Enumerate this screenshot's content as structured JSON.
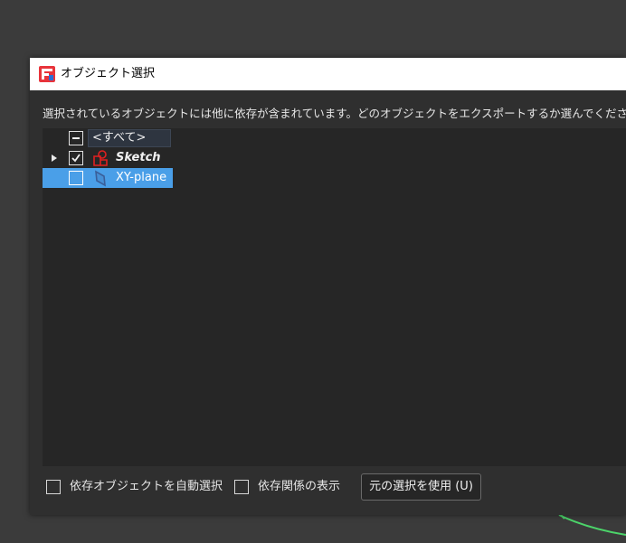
{
  "dialog": {
    "title": "オブジェクト選択",
    "message": "選択されているオブジェクトには他に依存が含まれています。どのオブジェクトをエクスポートするか選んでください。デ"
  },
  "tree": {
    "items": [
      {
        "label": "<すべて>",
        "check_state": "partial",
        "icon": "none"
      },
      {
        "label": "Sketch",
        "check_state": "checked",
        "icon": "sketch-icon",
        "expandable": true
      },
      {
        "label": "XY-plane",
        "check_state": "unchecked",
        "icon": "plane-icon",
        "selected": true
      }
    ]
  },
  "footer": {
    "auto_select_label": "依存オブジェクトを自動選択",
    "show_dependency_label": "依存関係の表示",
    "use_original_button": "元の選択を使用 (U)"
  },
  "colors": {
    "selection": "#4a9fe8",
    "background": "#2f2f2f",
    "tree_background": "#262626",
    "sketch_icon": "#e02020"
  }
}
